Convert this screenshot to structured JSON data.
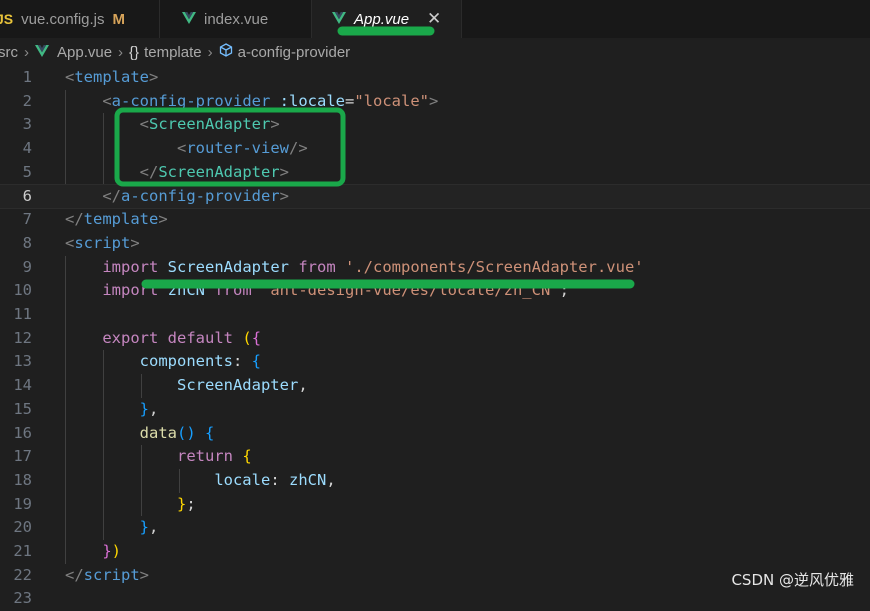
{
  "tabs": [
    {
      "icon": "JS",
      "label": "vue.config.js",
      "status": "M"
    },
    {
      "label": "index.vue"
    },
    {
      "label": "App.vue",
      "close": "✕"
    }
  ],
  "breadcrumb": {
    "items": [
      "src",
      "App.vue",
      "template",
      "a-config-provider"
    ],
    "braces": "{}"
  },
  "lines": [
    {
      "n": "1",
      "tokens": [
        [
          "t-punct",
          "<"
        ],
        [
          "t-tag",
          "template"
        ],
        [
          "t-punct",
          ">"
        ]
      ]
    },
    {
      "n": "2",
      "tokens": [
        [
          "",
          "    "
        ],
        [
          "t-punct",
          "<"
        ],
        [
          "t-tag",
          "a-config-provider"
        ],
        [
          "t-op",
          " "
        ],
        [
          "t-attr",
          ":locale"
        ],
        [
          "t-op",
          "="
        ],
        [
          "t-str",
          "\"locale\""
        ],
        [
          "t-punct",
          ">"
        ]
      ]
    },
    {
      "n": "3",
      "tokens": [
        [
          "",
          "        "
        ],
        [
          "t-punct",
          "<"
        ],
        [
          "t-comp",
          "ScreenAdapter"
        ],
        [
          "t-punct",
          ">"
        ]
      ]
    },
    {
      "n": "4",
      "tokens": [
        [
          "",
          "            "
        ],
        [
          "t-punct",
          "<"
        ],
        [
          "t-tag",
          "router-view"
        ],
        [
          "t-punct",
          "/>"
        ]
      ]
    },
    {
      "n": "5",
      "tokens": [
        [
          "",
          "        "
        ],
        [
          "t-punct",
          "</"
        ],
        [
          "t-comp",
          "ScreenAdapter"
        ],
        [
          "t-punct",
          ">"
        ]
      ]
    },
    {
      "n": "6",
      "tokens": [
        [
          "",
          "    "
        ],
        [
          "t-punct",
          "</"
        ],
        [
          "t-tag",
          "a-config-provider"
        ],
        [
          "t-punct",
          ">"
        ]
      ]
    },
    {
      "n": "7",
      "tokens": [
        [
          "t-punct",
          "</"
        ],
        [
          "t-tag",
          "template"
        ],
        [
          "t-punct",
          ">"
        ]
      ]
    },
    {
      "n": "8",
      "tokens": [
        [
          "t-punct",
          "<"
        ],
        [
          "t-tag",
          "script"
        ],
        [
          "t-punct",
          ">"
        ]
      ]
    },
    {
      "n": "9",
      "tokens": [
        [
          "",
          "    "
        ],
        [
          "t-kw",
          "import"
        ],
        [
          "t-op",
          " "
        ],
        [
          "t-var",
          "ScreenAdapter"
        ],
        [
          "t-op",
          " "
        ],
        [
          "t-kw",
          "from"
        ],
        [
          "t-op",
          " "
        ],
        [
          "t-str",
          "'./components/ScreenAdapter.vue'"
        ]
      ]
    },
    {
      "n": "10",
      "tokens": [
        [
          "",
          "    "
        ],
        [
          "t-kw",
          "import"
        ],
        [
          "t-op",
          " "
        ],
        [
          "t-var",
          "zhCN"
        ],
        [
          "t-op",
          " "
        ],
        [
          "t-kw",
          "from"
        ],
        [
          "t-op",
          " "
        ],
        [
          "t-str",
          "'ant-design-vue/es/locale/zh_CN'"
        ],
        [
          "t-op",
          ";"
        ]
      ]
    },
    {
      "n": "11",
      "tokens": []
    },
    {
      "n": "12",
      "tokens": [
        [
          "",
          "    "
        ],
        [
          "t-kw",
          "export"
        ],
        [
          "t-op",
          " "
        ],
        [
          "t-kw",
          "default"
        ],
        [
          "t-op",
          " "
        ],
        [
          "t-brk",
          "("
        ],
        [
          "t-brk2",
          "{"
        ]
      ]
    },
    {
      "n": "13",
      "tokens": [
        [
          "",
          "        "
        ],
        [
          "t-var",
          "components"
        ],
        [
          "t-op",
          ": "
        ],
        [
          "t-brk3",
          "{"
        ]
      ]
    },
    {
      "n": "14",
      "tokens": [
        [
          "",
          "            "
        ],
        [
          "t-var",
          "ScreenAdapter"
        ],
        [
          "t-op",
          ","
        ]
      ]
    },
    {
      "n": "15",
      "tokens": [
        [
          "",
          "        "
        ],
        [
          "t-brk3",
          "}"
        ],
        [
          "t-op",
          ","
        ]
      ]
    },
    {
      "n": "16",
      "tokens": [
        [
          "",
          "        "
        ],
        [
          "t-fn",
          "data"
        ],
        [
          "t-brk3",
          "()"
        ],
        [
          "t-op",
          " "
        ],
        [
          "t-brk3",
          "{"
        ]
      ]
    },
    {
      "n": "17",
      "tokens": [
        [
          "",
          "            "
        ],
        [
          "t-kw",
          "return"
        ],
        [
          "t-op",
          " "
        ],
        [
          "t-brk",
          "{"
        ]
      ]
    },
    {
      "n": "18",
      "tokens": [
        [
          "",
          "                "
        ],
        [
          "t-var",
          "locale"
        ],
        [
          "t-op",
          ": "
        ],
        [
          "t-var",
          "zhCN"
        ],
        [
          "t-op",
          ","
        ]
      ]
    },
    {
      "n": "19",
      "tokens": [
        [
          "",
          "            "
        ],
        [
          "t-brk",
          "}"
        ],
        [
          "t-op",
          ";"
        ]
      ]
    },
    {
      "n": "20",
      "tokens": [
        [
          "",
          "        "
        ],
        [
          "t-brk3",
          "}"
        ],
        [
          "t-op",
          ","
        ]
      ]
    },
    {
      "n": "21",
      "tokens": [
        [
          "",
          "    "
        ],
        [
          "t-brk2",
          "}"
        ],
        [
          "t-brk",
          ")"
        ]
      ]
    },
    {
      "n": "22",
      "tokens": [
        [
          "t-punct",
          "</"
        ],
        [
          "t-tag",
          "script"
        ],
        [
          "t-punct",
          ">"
        ]
      ]
    },
    {
      "n": "23",
      "tokens": []
    }
  ],
  "current_line": "6",
  "colors": {
    "annotation": "#1aa84a",
    "background": "#1f1f1f"
  },
  "watermark": "CSDN @逆风优雅"
}
